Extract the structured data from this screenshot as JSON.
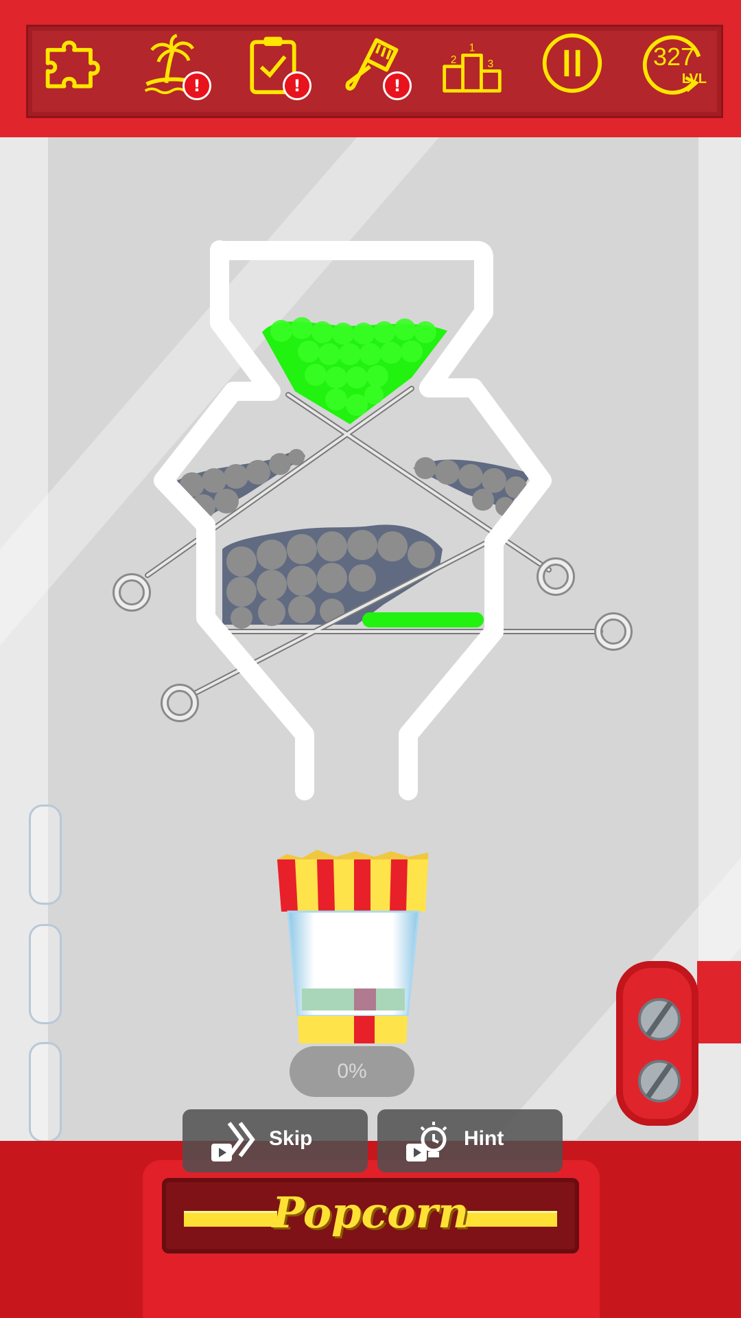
{
  "topbar": {
    "icons": [
      "puzzle-icon",
      "island-icon",
      "clipboard-icon",
      "paintbrush-icon",
      "podium-icon",
      "pause-icon",
      "level-icon"
    ],
    "badge_text": "!",
    "podium_places": [
      "2",
      "1",
      "3"
    ],
    "level_number": "327",
    "level_label": "LVL"
  },
  "game": {
    "progress_text": "0%",
    "skip_label": "Skip",
    "hint_label": "Hint",
    "title": "Popcorn"
  },
  "colors": {
    "red": "#e0252c",
    "yellow": "#ffe600",
    "green_balls": "#21f20f",
    "gray_balls": "#6b7280"
  }
}
